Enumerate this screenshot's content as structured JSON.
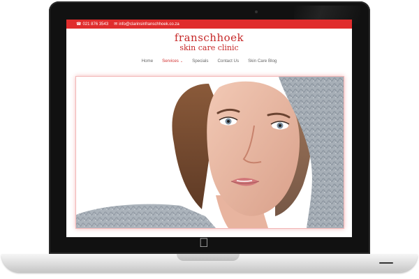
{
  "topbar": {
    "phone": "021 876 3543",
    "email": "info@clarinsinfranschhoek.co.za",
    "phone_icon": "phone-icon",
    "email_icon": "envelope-icon"
  },
  "logo": {
    "line1": "franschhoek",
    "line2": "skin care clinic"
  },
  "nav": {
    "items": [
      {
        "label": "Home"
      },
      {
        "label": "Services"
      },
      {
        "label": "Specials"
      },
      {
        "label": "Contact Us"
      },
      {
        "label": "Skin Care Blog"
      }
    ],
    "active_index": 1
  },
  "colors": {
    "brand_red": "#e02d2d",
    "logo_red": "#c62828"
  },
  "device": {
    "brand_icon": "apple-logo-icon"
  }
}
